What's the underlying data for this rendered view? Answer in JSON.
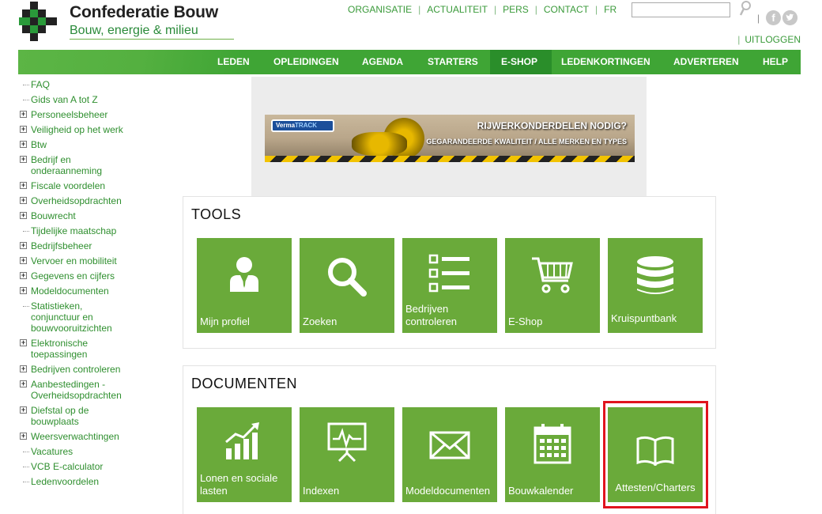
{
  "brand": {
    "title": "Confederatie Bouw",
    "subtitle": "Bouw, energie & milieu"
  },
  "topnav": {
    "links": [
      "ORGANISATIE",
      "ACTUALITEIT",
      "PERS",
      "CONTACT",
      "FR"
    ],
    "search_value": "",
    "social": [
      "facebook-icon",
      "twitter-icon"
    ],
    "logout": "UITLOGGEN"
  },
  "mainnav": {
    "items": [
      "LEDEN",
      "OPLEIDINGEN",
      "AGENDA",
      "STARTERS",
      "E-SHOP",
      "LEDENKORTINGEN",
      "ADVERTEREN",
      "HELP"
    ],
    "active": "E-SHOP",
    "color": "#3fa535"
  },
  "sidebar": {
    "items": [
      {
        "label": "FAQ",
        "expandable": false
      },
      {
        "label": "Gids van A tot Z",
        "expandable": false
      },
      {
        "label": "Personeelsbeheer",
        "expandable": true
      },
      {
        "label": "Veiligheid op het werk",
        "expandable": true
      },
      {
        "label": "Btw",
        "expandable": true
      },
      {
        "label": "Bedrijf en onderaanneming",
        "expandable": true
      },
      {
        "label": "Fiscale voordelen",
        "expandable": true
      },
      {
        "label": "Overheidsopdrachten",
        "expandable": true
      },
      {
        "label": "Bouwrecht",
        "expandable": true
      },
      {
        "label": "Tijdelijke maatschap",
        "expandable": false
      },
      {
        "label": "Bedrijfsbeheer",
        "expandable": true
      },
      {
        "label": "Vervoer en mobiliteit",
        "expandable": true
      },
      {
        "label": "Gegevens en cijfers",
        "expandable": true
      },
      {
        "label": "Modeldocumenten",
        "expandable": true
      },
      {
        "label": "Statistieken, conjunctuur en bouwvooruitzichten",
        "expandable": false
      },
      {
        "label": "Elektronische toepassingen",
        "expandable": true
      },
      {
        "label": "Bedrijven controleren",
        "expandable": true
      },
      {
        "label": "Aanbestedingen - Overheidsopdrachten",
        "expandable": true
      },
      {
        "label": "Diefstal op de bouwplaats",
        "expandable": true
      },
      {
        "label": "Weersverwachtingen",
        "expandable": true
      },
      {
        "label": "Vacatures",
        "expandable": false
      },
      {
        "label": "VCB E-calculator",
        "expandable": false
      },
      {
        "label": "Ledenvoordelen",
        "expandable": false
      }
    ]
  },
  "ad": {
    "brand_prefix": "Verma",
    "brand_suffix": "TRACK",
    "headline": "RIJWERKONDERDELEN NODIG?",
    "tagline": "GEGARANDEERDE KWALITEIT / ALLE MERKEN EN TYPES"
  },
  "tools": {
    "title": "TOOLS",
    "tiles": [
      {
        "label": "Mijn profiel",
        "icon": "user-icon"
      },
      {
        "label": "Zoeken",
        "icon": "magnifier-icon"
      },
      {
        "label": "Bedrijven controleren",
        "icon": "checklist-icon"
      },
      {
        "label": "E-Shop",
        "icon": "cart-icon"
      },
      {
        "label": "Kruispuntbank",
        "icon": "database-icon"
      }
    ]
  },
  "documents": {
    "title": "DOCUMENTEN",
    "tiles": [
      {
        "label": "Lonen en sociale lasten",
        "icon": "bar-chart-icon"
      },
      {
        "label": "Indexen",
        "icon": "presentation-icon"
      },
      {
        "label": "Modeldocumenten",
        "icon": "envelope-icon"
      },
      {
        "label": "Bouwkalender",
        "icon": "calendar-icon"
      },
      {
        "label": "Attesten/Charters",
        "icon": "book-icon"
      }
    ]
  },
  "colors": {
    "tile": "#6aaa3a",
    "highlight": "#e0141e",
    "link": "#3a9a3a"
  }
}
